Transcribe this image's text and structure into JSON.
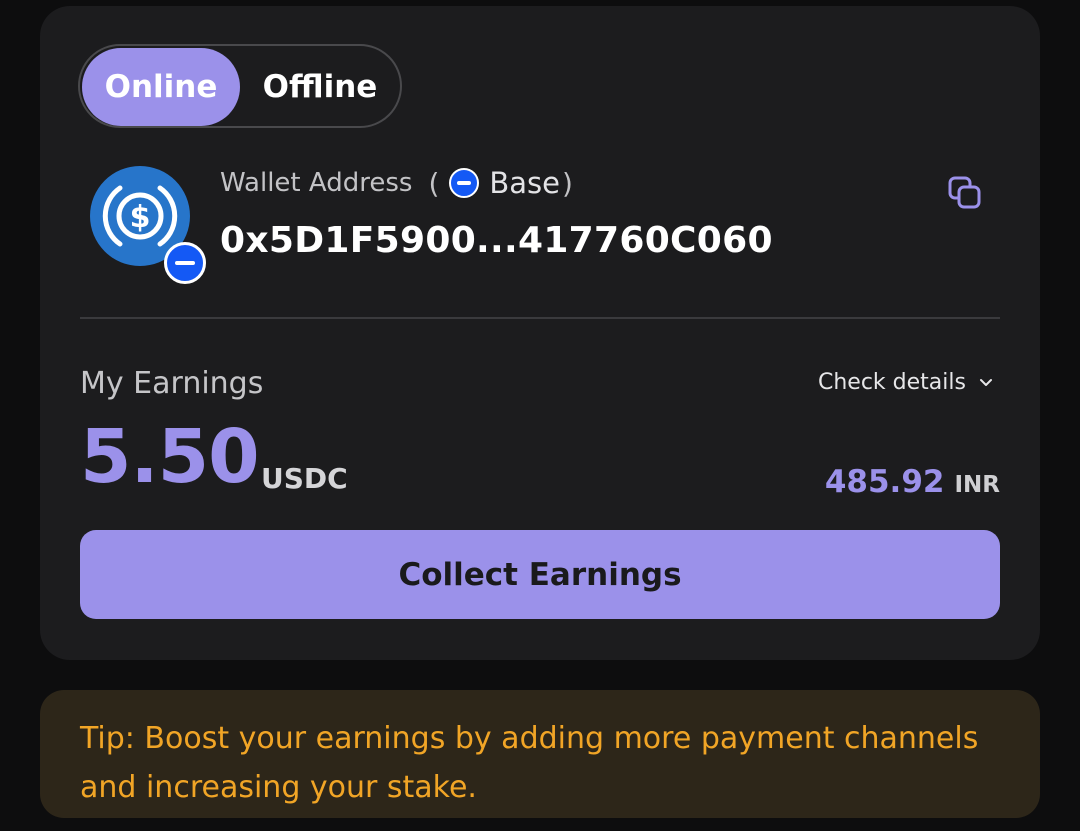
{
  "status_toggle": {
    "online_label": "Online",
    "offline_label": "Offline",
    "selected": "Online"
  },
  "wallet": {
    "label": "Wallet Address",
    "paren_open": "(",
    "paren_close": ")",
    "network": "Base",
    "address": "0x5D1F5900...417760C060",
    "token_icon": "usdc-icon",
    "network_icon": "base-network-icon",
    "copy_icon": "copy-icon"
  },
  "earnings": {
    "title": "My Earnings",
    "check_details_label": "Check details",
    "amount": "5.50",
    "unit": "USDC",
    "fiat_amount": "485.92",
    "fiat_unit": "INR",
    "collect_label": "Collect Earnings"
  },
  "tip": {
    "text": "Tip: Boost your earnings by adding more payment channels and increasing your stake."
  },
  "colors": {
    "accent": "#9b91ea",
    "card_bg": "#1c1c1e",
    "page_bg": "#0d0d0e",
    "usdc_blue": "#2775ca",
    "base_blue": "#1459f5",
    "tip_bg": "#2d2619",
    "tip_text": "#f1a526"
  }
}
